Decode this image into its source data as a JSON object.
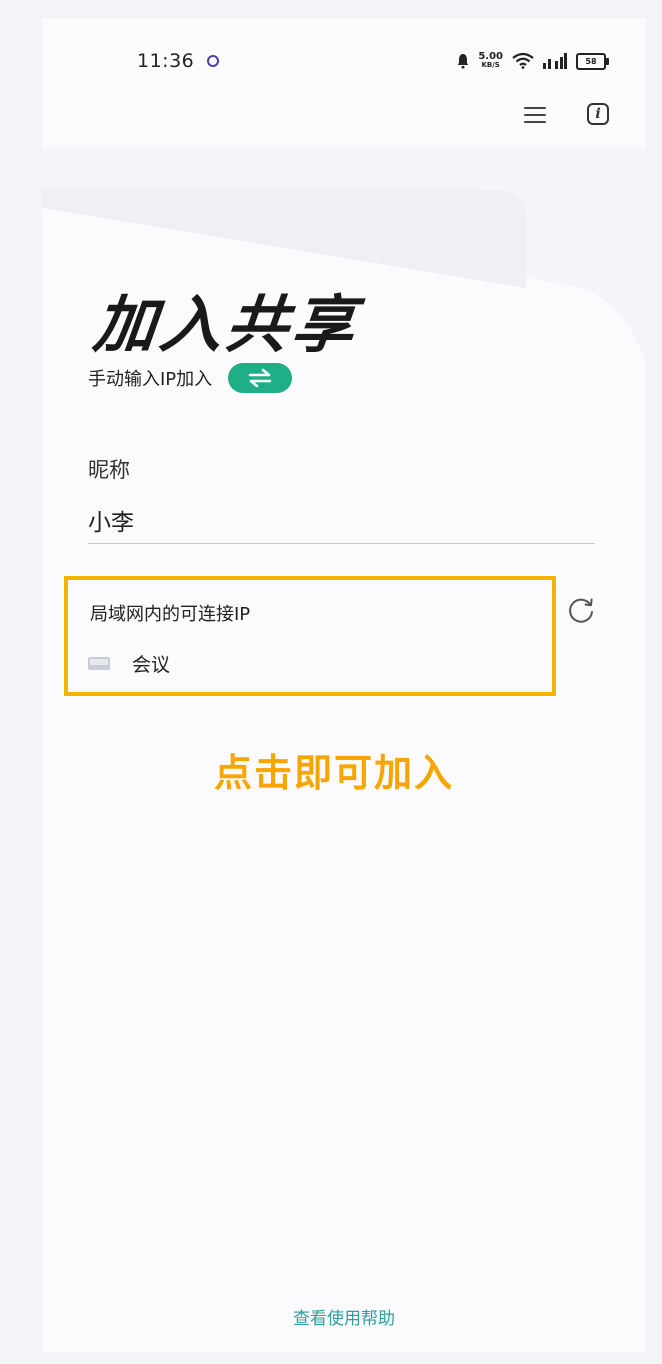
{
  "status_bar": {
    "time": "11:36",
    "net_speed_value": "5.00",
    "net_speed_unit": "KB/S",
    "battery_level": "58"
  },
  "header": {
    "menu_icon": "menu-icon",
    "info_icon": "info-icon",
    "info_glyph": "i"
  },
  "main": {
    "title": "加入共享",
    "manual_entry_label": "手动输入IP加入",
    "swap_icon": "swap-arrows-icon",
    "nickname_label": "昵称",
    "nickname_value": "小李",
    "lan_section_title": "局域网内的可连接IP",
    "lan_devices": [
      {
        "label": "会议",
        "icon": "laptop-icon"
      }
    ],
    "refresh_icon": "refresh-icon",
    "click_hint": "点击即可加入"
  },
  "footer": {
    "help_link": "查看使用帮助"
  },
  "colors": {
    "accent_green": "#1fae86",
    "highlight_orange": "#f5b400",
    "hint_orange": "#f7a500",
    "link_teal": "#2e9fa0"
  }
}
